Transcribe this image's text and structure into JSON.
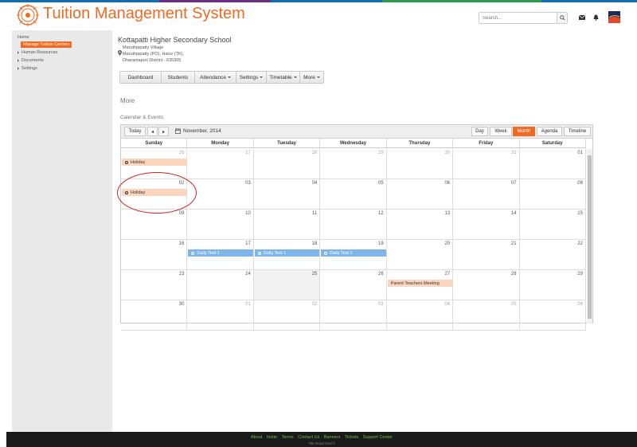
{
  "app": {
    "title": "Tuition Management System",
    "brand_color": "#f26a21",
    "stripe_colors": [
      "#0f6eb5",
      "#6b2d86",
      "#0f6eb5",
      "#2e9b4f",
      "#0f6eb5"
    ]
  },
  "header": {
    "search_placeholder": "Search...",
    "icons": [
      "search-icon",
      "mail-icon",
      "bell-icon",
      "avatar"
    ]
  },
  "sidebar": {
    "items": [
      {
        "label": "Home"
      },
      {
        "label": "Manage Tuition  Centers",
        "active": true
      },
      {
        "label": "Human Resources"
      },
      {
        "label": "Documents"
      },
      {
        "label": "Settings"
      }
    ]
  },
  "school": {
    "name": "Kottapatti Higher Secondary School",
    "address": [
      "Maruthippatty Village",
      "Maruthippatty (PO), Harur (TK),",
      "Dharamapuri District - 635305"
    ]
  },
  "menu": [
    {
      "label": "Dashboard",
      "dropdown": false
    },
    {
      "label": "Students",
      "dropdown": false
    },
    {
      "label": "Attendance",
      "dropdown": true
    },
    {
      "label": "Settings",
      "dropdown": true
    },
    {
      "label": "Timetable",
      "dropdown": true
    },
    {
      "label": "More",
      "dropdown": true
    }
  ],
  "page": {
    "heading": "More",
    "section": "Calendar & Events"
  },
  "calendar": {
    "today_label": "Today",
    "prev_label": "◂",
    "next_label": "▸",
    "month_label": "November, 2014",
    "views": [
      {
        "label": "Day",
        "active": false
      },
      {
        "label": "Week",
        "active": false
      },
      {
        "label": "Month",
        "active": true
      },
      {
        "label": "Agenda",
        "active": false
      },
      {
        "label": "Timeline",
        "active": false
      }
    ],
    "weekdays": [
      "Sunday",
      "Monday",
      "Tuesday",
      "Wednesday",
      "Thursday",
      "Friday",
      "Saturday"
    ],
    "weeks": [
      [
        {
          "d": "26",
          "o": true
        },
        {
          "d": "27",
          "o": true
        },
        {
          "d": "28",
          "o": true
        },
        {
          "d": "29",
          "o": true
        },
        {
          "d": "30",
          "o": true
        },
        {
          "d": "31",
          "o": true
        },
        {
          "d": "01"
        }
      ],
      [
        {
          "d": "02"
        },
        {
          "d": "03"
        },
        {
          "d": "04"
        },
        {
          "d": "05"
        },
        {
          "d": "06"
        },
        {
          "d": "07"
        },
        {
          "d": "08"
        }
      ],
      [
        {
          "d": "09"
        },
        {
          "d": "10"
        },
        {
          "d": "11"
        },
        {
          "d": "12"
        },
        {
          "d": "13"
        },
        {
          "d": "14"
        },
        {
          "d": "15"
        }
      ],
      [
        {
          "d": "16"
        },
        {
          "d": "17"
        },
        {
          "d": "18"
        },
        {
          "d": "19"
        },
        {
          "d": "20"
        },
        {
          "d": "21"
        },
        {
          "d": "22"
        }
      ],
      [
        {
          "d": "23"
        },
        {
          "d": "24"
        },
        {
          "d": "25",
          "today": true
        },
        {
          "d": "26"
        },
        {
          "d": "27"
        },
        {
          "d": "28"
        },
        {
          "d": "29"
        }
      ],
      [
        {
          "d": "30"
        },
        {
          "d": "01",
          "o": true
        },
        {
          "d": "02",
          "o": true
        },
        {
          "d": "03",
          "o": true
        },
        {
          "d": "04",
          "o": true
        },
        {
          "d": "05",
          "o": true
        },
        {
          "d": "06",
          "o": true
        }
      ]
    ],
    "events": [
      {
        "week": 0,
        "day": 0,
        "label": "Holiday",
        "kind": "hol",
        "icon": "clock-icon"
      },
      {
        "week": 1,
        "day": 0,
        "label": "Holiday",
        "kind": "hol",
        "icon": "clock-icon"
      },
      {
        "week": 3,
        "day": 1,
        "label": "Daily Test 1",
        "kind": "test",
        "icon": "clock-icon"
      },
      {
        "week": 3,
        "day": 2,
        "label": "Daily Test 1",
        "kind": "test",
        "icon": "clock-icon"
      },
      {
        "week": 3,
        "day": 3,
        "label": "Daily Test 1",
        "kind": "test",
        "icon": "clock-icon"
      },
      {
        "week": 4,
        "day": 4,
        "label": "Parent Teachers Meeting",
        "kind": "ptm",
        "icon": ""
      }
    ]
  },
  "footer": {
    "links": [
      "About",
      "Invite",
      "Terms",
      "Contact Us",
      "Banners",
      "Tickets",
      "Support Center"
    ],
    "copyright": "The Good Grid ©"
  }
}
